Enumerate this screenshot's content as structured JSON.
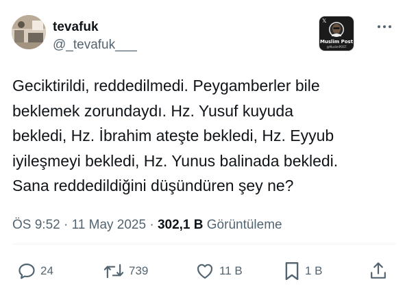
{
  "author": {
    "display_name": "tevafuk",
    "handle": "@_tevafuk___"
  },
  "badge": {
    "x_label": "𝕏",
    "name": "Muslim Post",
    "sub": "@MuslimPOST"
  },
  "tweet": {
    "lines": [
      "Geciktirildi, reddedilmedi. Peygamberler bile",
      "beklemek zorundaydı. Hz. Yusuf kuyuda",
      "bekledi, Hz. İbrahim ateşte bekledi, Hz. Eyyub",
      "iyileşmeyi bekledi, Hz. Yunus balinada bekledi.",
      "Sana reddedildiğini düşündüren şey ne?"
    ]
  },
  "meta": {
    "time": "ÖS 9:52",
    "separator": "·",
    "date": "11 May 2025",
    "views_count": "302,1 B",
    "views_label": "Görüntüleme"
  },
  "actions": {
    "reply_count": "24",
    "retweet_count": "739",
    "like_count": "11 B",
    "bookmark_count": "1 B"
  },
  "icons": {
    "reply": "reply-icon",
    "retweet": "retweet-icon",
    "like": "heart-icon",
    "bookmark": "bookmark-icon",
    "share": "share-icon",
    "more": "more-horizontal-icon"
  },
  "colors": {
    "text": "#0f1419",
    "secondary": "#536471",
    "divider": "#eff3f4",
    "background": "#ffffff"
  }
}
